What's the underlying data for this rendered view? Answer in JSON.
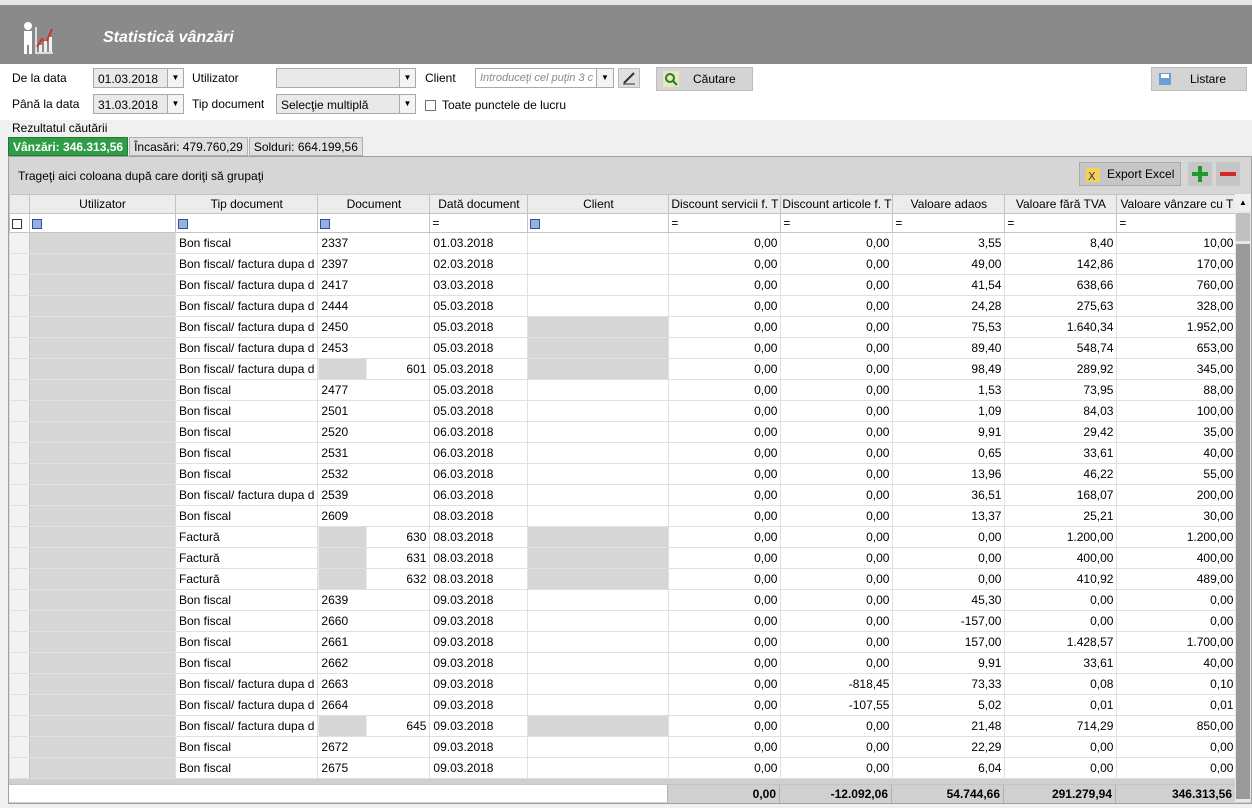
{
  "app": {
    "title": "Statistică vânzări",
    "logo_icon": "chart-person-icon"
  },
  "filters": {
    "from_label": "De la data",
    "from_value": "01.03.2018",
    "to_label": "Până la data",
    "to_value": "31.03.2018",
    "user_label": "Utilizator",
    "user_value": "",
    "doctype_label": "Tip document",
    "doctype_value": "Selecţie multiplă",
    "client_label": "Client",
    "client_placeholder": "Introduceţi cel puţin 3 c",
    "all_points_label": "Toate punctele de lucru",
    "search_button": "Căutare",
    "list_button": "Listare"
  },
  "results_label": "Rezultatul căutării",
  "tabs": [
    {
      "label": "Vânzări: 346.313,56",
      "active": true
    },
    {
      "label": "Încasări: 479.760,29",
      "active": false
    },
    {
      "label": "Solduri: 664.199,56",
      "active": false
    }
  ],
  "grid": {
    "group_hint": "Trageţi aici coloana după care doriţi să grupaţi",
    "export_button": "Export Excel",
    "columns": [
      "Utilizator",
      "Tip document",
      "Document",
      "Dată document",
      "Client",
      "Discount servicii f. T",
      "Discount articole f. T",
      "Valoare adaos",
      "Valoare fără TVA",
      "Valoare vânzare cu T"
    ],
    "rows": [
      [
        "Bon fiscal",
        "2337",
        "01.03.2018",
        "0,00",
        "0,00",
        "3,55",
        "8,40",
        "10,00"
      ],
      [
        "Bon fiscal/ factura dupa d",
        "2397",
        "02.03.2018",
        "0,00",
        "0,00",
        "49,00",
        "142,86",
        "170,00"
      ],
      [
        "Bon fiscal/ factura dupa d",
        "2417",
        "03.03.2018",
        "0,00",
        "0,00",
        "41,54",
        "638,66",
        "760,00"
      ],
      [
        "Bon fiscal/ factura dupa d",
        "2444",
        "05.03.2018",
        "0,00",
        "0,00",
        "24,28",
        "275,63",
        "328,00"
      ],
      [
        "Bon fiscal/ factura dupa d",
        "2450",
        "05.03.2018",
        "0,00",
        "0,00",
        "75,53",
        "1.640,34",
        "1.952,00"
      ],
      [
        "Bon fiscal/ factura dupa d",
        "2453",
        "05.03.2018",
        "0,00",
        "0,00",
        "89,40",
        "548,74",
        "653,00"
      ],
      [
        "Bon fiscal/ factura dupa d",
        "601",
        "05.03.2018",
        "0,00",
        "0,00",
        "98,49",
        "289,92",
        "345,00"
      ],
      [
        "Bon fiscal",
        "2477",
        "05.03.2018",
        "0,00",
        "0,00",
        "1,53",
        "73,95",
        "88,00"
      ],
      [
        "Bon fiscal",
        "2501",
        "05.03.2018",
        "0,00",
        "0,00",
        "1,09",
        "84,03",
        "100,00"
      ],
      [
        "Bon fiscal",
        "2520",
        "06.03.2018",
        "0,00",
        "0,00",
        "9,91",
        "29,42",
        "35,00"
      ],
      [
        "Bon fiscal",
        "2531",
        "06.03.2018",
        "0,00",
        "0,00",
        "0,65",
        "33,61",
        "40,00"
      ],
      [
        "Bon fiscal",
        "2532",
        "06.03.2018",
        "0,00",
        "0,00",
        "13,96",
        "46,22",
        "55,00"
      ],
      [
        "Bon fiscal/ factura dupa d",
        "2539",
        "06.03.2018",
        "0,00",
        "0,00",
        "36,51",
        "168,07",
        "200,00"
      ],
      [
        "Bon fiscal",
        "2609",
        "08.03.2018",
        "0,00",
        "0,00",
        "13,37",
        "25,21",
        "30,00"
      ],
      [
        "Factură",
        "630",
        "08.03.2018",
        "0,00",
        "0,00",
        "0,00",
        "1.200,00",
        "1.200,00"
      ],
      [
        "Factură",
        "631",
        "08.03.2018",
        "0,00",
        "0,00",
        "0,00",
        "400,00",
        "400,00"
      ],
      [
        "Factură",
        "632",
        "08.03.2018",
        "0,00",
        "0,00",
        "0,00",
        "410,92",
        "489,00"
      ],
      [
        "Bon fiscal",
        "2639",
        "09.03.2018",
        "0,00",
        "0,00",
        "45,30",
        "0,00",
        "0,00"
      ],
      [
        "Bon fiscal",
        "2660",
        "09.03.2018",
        "0,00",
        "0,00",
        "-157,00",
        "0,00",
        "0,00"
      ],
      [
        "Bon fiscal",
        "2661",
        "09.03.2018",
        "0,00",
        "0,00",
        "157,00",
        "1.428,57",
        "1.700,00"
      ],
      [
        "Bon fiscal",
        "2662",
        "09.03.2018",
        "0,00",
        "0,00",
        "9,91",
        "33,61",
        "40,00"
      ],
      [
        "Bon fiscal/ factura dupa d",
        "2663",
        "09.03.2018",
        "0,00",
        "-818,45",
        "73,33",
        "0,08",
        "0,10"
      ],
      [
        "Bon fiscal/ factura dupa d",
        "2664",
        "09.03.2018",
        "0,00",
        "-107,55",
        "5,02",
        "0,01",
        "0,01"
      ],
      [
        "Bon fiscal/ factura dupa d",
        "645",
        "09.03.2018",
        "0,00",
        "0,00",
        "21,48",
        "714,29",
        "850,00"
      ],
      [
        "Bon fiscal",
        "2672",
        "09.03.2018",
        "0,00",
        "0,00",
        "22,29",
        "0,00",
        "0,00"
      ],
      [
        "Bon fiscal",
        "2675",
        "09.03.2018",
        "0,00",
        "0,00",
        "6,04",
        "0,00",
        "0,00"
      ]
    ],
    "totals": [
      "0,00",
      "-12.092,06",
      "54.744,66",
      "291.279,94",
      "346.313,56"
    ]
  }
}
